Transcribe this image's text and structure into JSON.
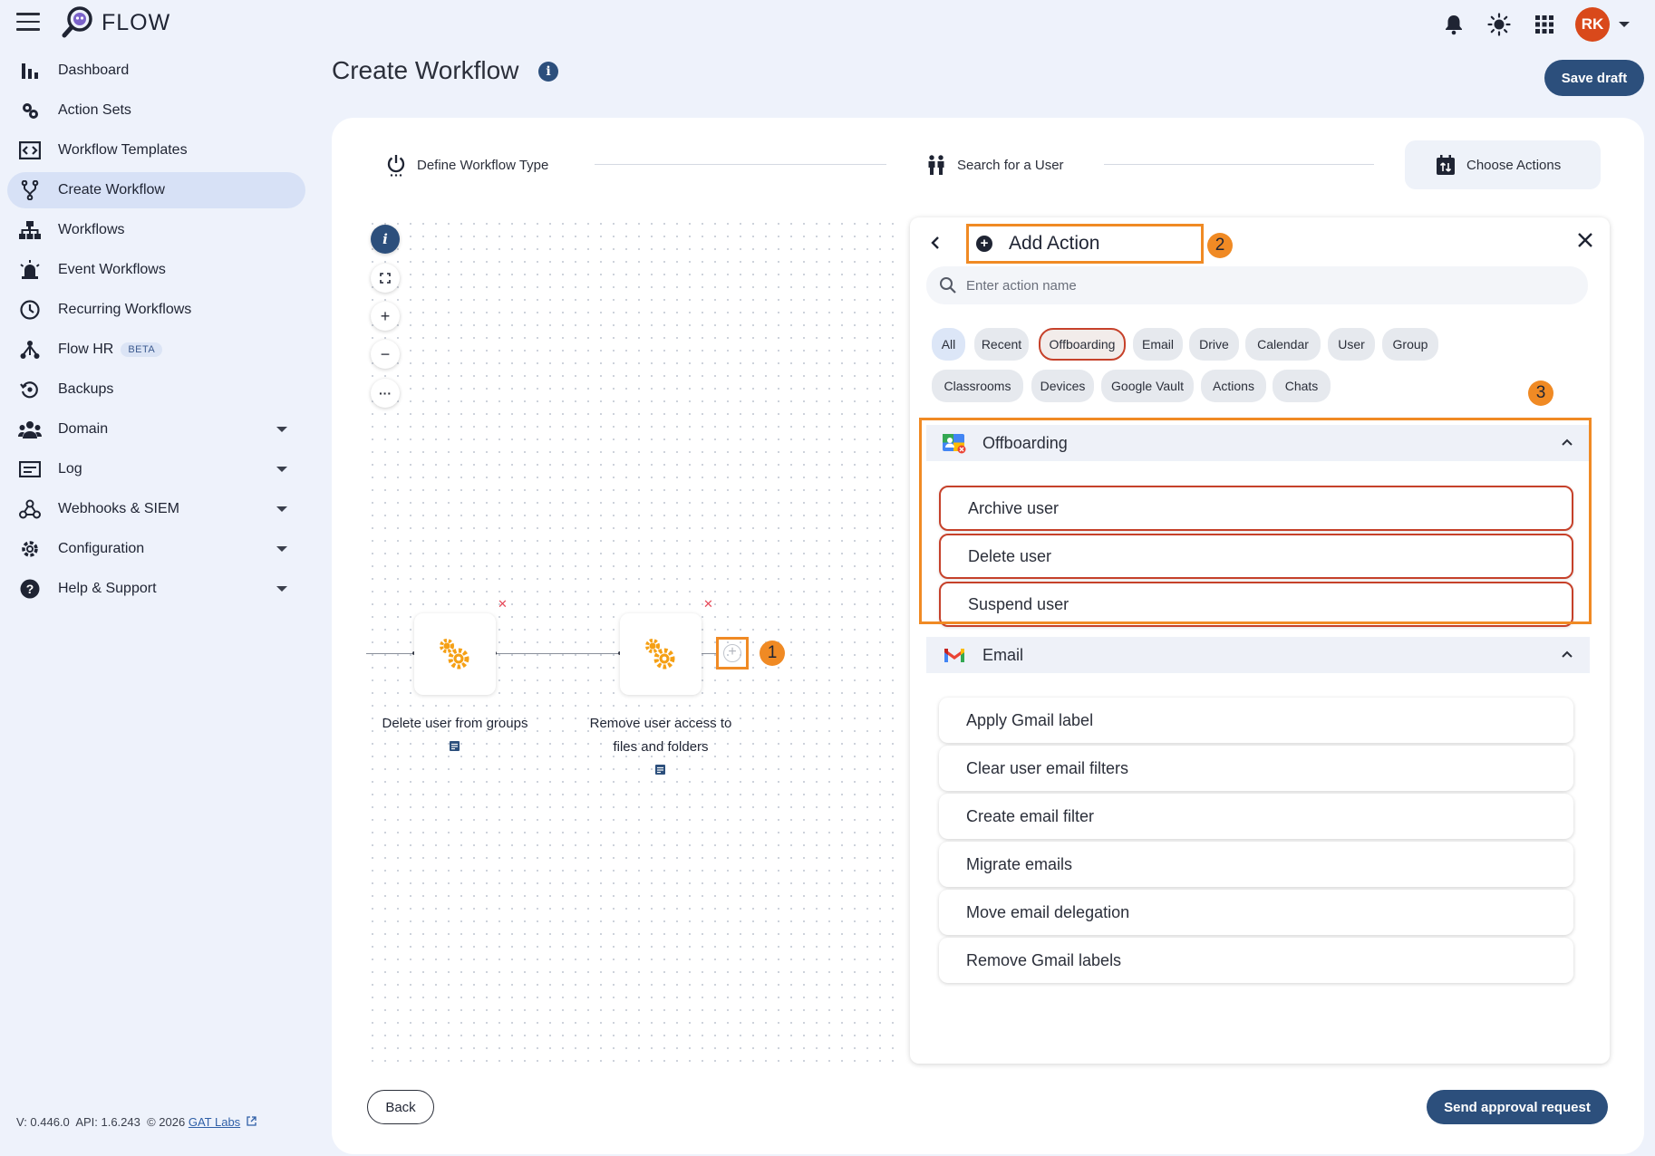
{
  "app": {
    "name": "FLOW",
    "user_initials": "RK"
  },
  "sidebar": {
    "items": [
      {
        "label": "Dashboard"
      },
      {
        "label": "Action Sets"
      },
      {
        "label": "Workflow Templates"
      },
      {
        "label": "Create Workflow"
      },
      {
        "label": "Workflows"
      },
      {
        "label": "Event Workflows"
      },
      {
        "label": "Recurring Workflows"
      },
      {
        "label": "Flow HR",
        "badge": "BETA"
      },
      {
        "label": "Backups"
      },
      {
        "label": "Domain"
      },
      {
        "label": "Log"
      },
      {
        "label": "Webhooks & SIEM"
      },
      {
        "label": "Configuration"
      },
      {
        "label": "Help & Support"
      }
    ],
    "footer": {
      "version": "V: 0.446.0",
      "api": "API: 1.6.243",
      "copyright": "© 2026",
      "company": "GAT Labs"
    }
  },
  "header": {
    "title": "Create Workflow",
    "save_label": "Save draft"
  },
  "stepper": {
    "steps": [
      {
        "label": "Define Workflow Type"
      },
      {
        "label": "Search for a User"
      },
      {
        "label": "Choose Actions"
      }
    ]
  },
  "canvas": {
    "nodes": [
      {
        "label": "Delete user from groups"
      },
      {
        "label_line1": "Remove user access to",
        "label_line2": "files and folders"
      }
    ],
    "annotation_badges": [
      "1",
      "2",
      "3"
    ]
  },
  "panel": {
    "title": "Add Action",
    "search_placeholder": "Enter action name",
    "chips": [
      "All",
      "Recent",
      "Offboarding",
      "Email",
      "Drive",
      "Calendar",
      "User",
      "Group",
      "Classrooms",
      "Devices",
      "Google Vault",
      "Actions",
      "Chats"
    ],
    "sections": [
      {
        "name": "Offboarding",
        "actions": [
          "Archive user",
          "Delete user",
          "Suspend user"
        ]
      },
      {
        "name": "Email",
        "actions": [
          "Apply Gmail label",
          "Clear user email filters",
          "Create email filter",
          "Migrate emails",
          "Move email delegation",
          "Remove Gmail labels"
        ]
      }
    ]
  },
  "footer_buttons": {
    "back": "Back",
    "send": "Send approval request"
  },
  "colors": {
    "accent": "#2c4f7c",
    "annotation": "#f08a24",
    "highlight_border": "#c6412a",
    "gear": "#f5a015"
  }
}
